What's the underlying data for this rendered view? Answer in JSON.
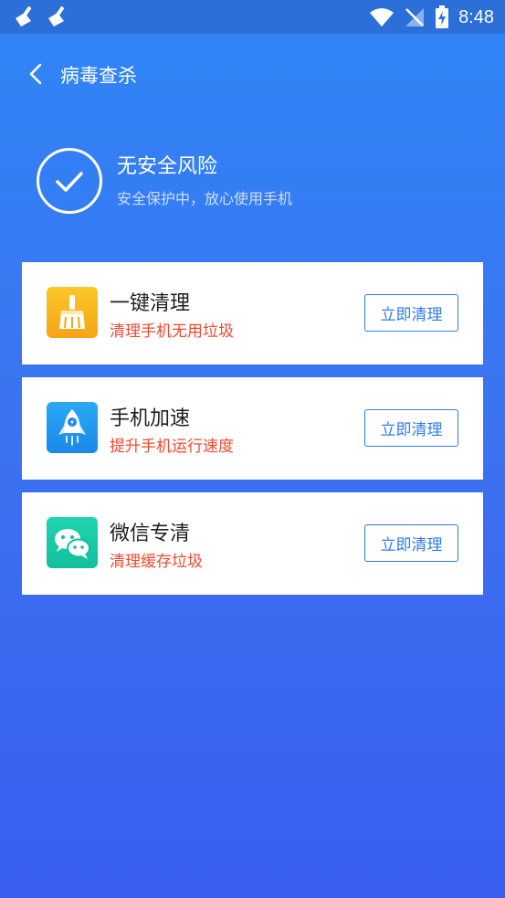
{
  "status_bar": {
    "time": "8:48",
    "icons": [
      "broom-icon",
      "broom-icon",
      "wifi-icon",
      "no-signal-icon",
      "battery-charging-icon"
    ]
  },
  "header": {
    "title": "病毒查杀"
  },
  "security": {
    "title": "无安全风险",
    "subtitle": "安全保护中，放心使用手机"
  },
  "cards": [
    {
      "title": "一键清理",
      "subtitle": "清理手机无用垃圾",
      "button": "立即清理",
      "icon": "broom-icon",
      "icon_color": "#f7b21b"
    },
    {
      "title": "手机加速",
      "subtitle": "提升手机运行速度",
      "button": "立即清理",
      "icon": "rocket-icon",
      "icon_color": "#2196f3"
    },
    {
      "title": "微信专清",
      "subtitle": "清理缓存垃圾",
      "button": "立即清理",
      "icon": "wechat-icon",
      "icon_color": "#19c7a4"
    }
  ],
  "colors": {
    "accent": "#2f7bf0",
    "warning_text": "#f04a2e"
  }
}
